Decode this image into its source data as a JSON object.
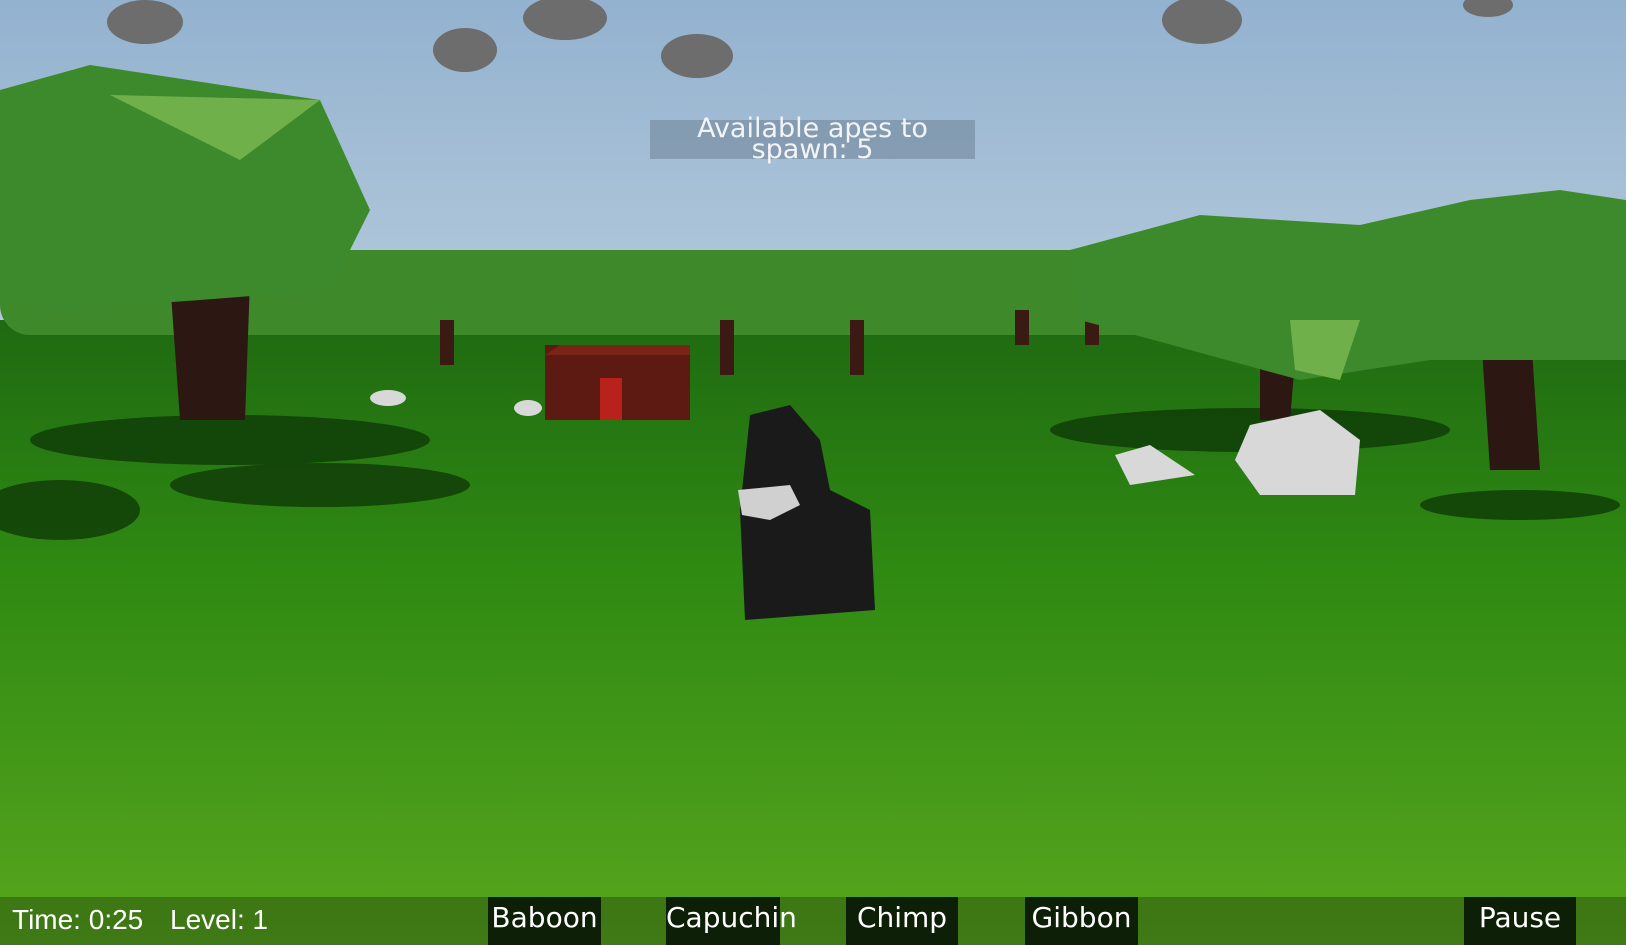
{
  "spawn_banner": {
    "text": "Available apes to spawn: 5"
  },
  "hud": {
    "time_label": "Time: 0:25",
    "level_label": "Level: 1",
    "ape_buttons": [
      {
        "label": "Baboon"
      },
      {
        "label": "Capuchin"
      },
      {
        "label": "Chimp"
      },
      {
        "label": "Gibbon"
      }
    ],
    "pause_label": "Pause"
  },
  "colors": {
    "sky": "#94b3cf",
    "grass": "#2f8a12",
    "tree_canopy": "#3f8f2a",
    "hut": "#6b1a12"
  }
}
